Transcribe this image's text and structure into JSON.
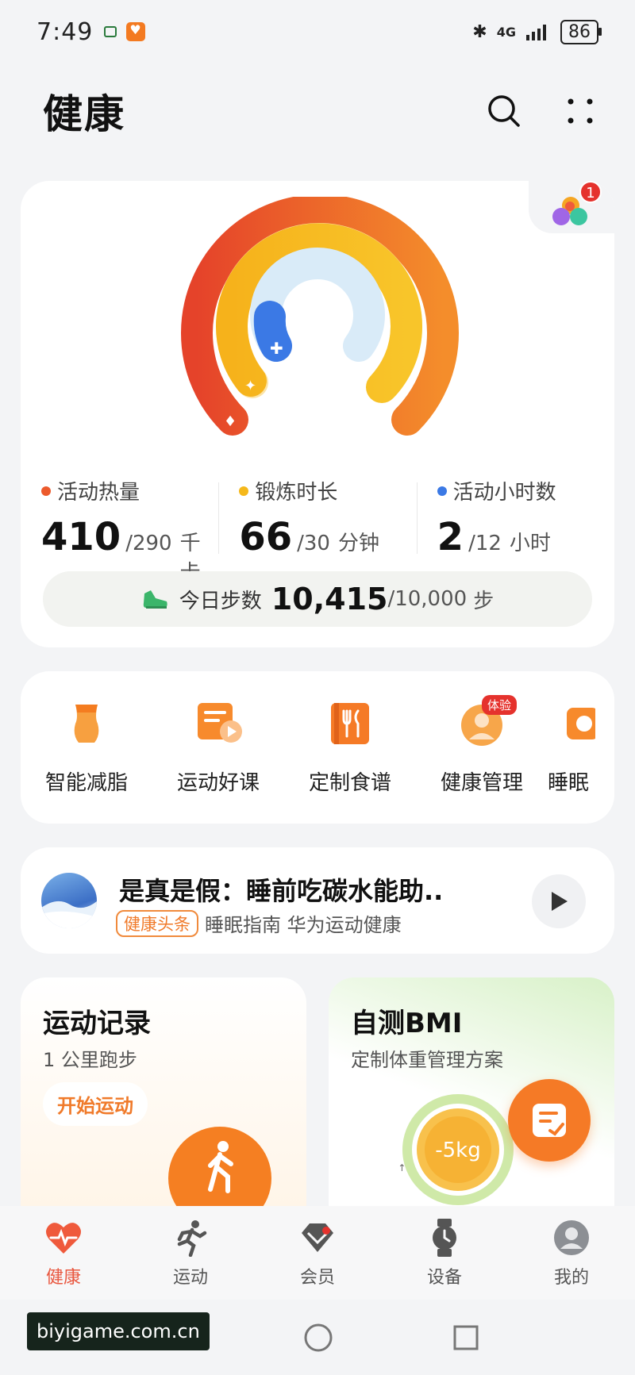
{
  "status_bar": {
    "time": "7:49",
    "network": "4G",
    "battery": "86"
  },
  "header": {
    "title": "健康"
  },
  "activity": {
    "metrics": [
      {
        "label": "活动热量",
        "value": "410",
        "goal": "/290",
        "unit": "千卡",
        "color": "#ec5a2c",
        "progress": 1.41
      },
      {
        "label": "锻炼时长",
        "value": "66",
        "goal": "/30",
        "unit": "分钟",
        "color": "#f5b81b",
        "progress": 2.2
      },
      {
        "label": "活动小时数",
        "value": "2",
        "goal": "/12",
        "unit": "小时",
        "color": "#3b79e5",
        "progress": 0.17
      }
    ],
    "steps": {
      "label": "今日步数",
      "value": "10,415",
      "goal": "/10,000",
      "unit": "步"
    },
    "notification_count": "1"
  },
  "services": [
    {
      "label": "智能减脂",
      "icon": "waist-icon"
    },
    {
      "label": "运动好课",
      "icon": "video-course-icon"
    },
    {
      "label": "定制食谱",
      "icon": "recipe-icon"
    },
    {
      "label": "健康管理",
      "icon": "health-manager-icon",
      "badge": "体验"
    },
    {
      "label": "睡眠",
      "icon": "sleep-icon"
    }
  ],
  "article": {
    "title": "是真是假：睡前吃碳水能助..",
    "tag": "健康头条",
    "meta": "睡眠指南 华为运动健康"
  },
  "record_card": {
    "title": "运动记录",
    "subtitle": "1 公里跑步",
    "button": "开始运动"
  },
  "bmi_card": {
    "title": "自测BMI",
    "subtitle": "定制体重管理方案",
    "gauge_label": "-5kg",
    "gauge_hint": "%↑"
  },
  "bottom_nav": [
    {
      "label": "健康",
      "icon": "heart-pulse-icon",
      "active": true
    },
    {
      "label": "运动",
      "icon": "runner-icon",
      "active": false
    },
    {
      "label": "会员",
      "icon": "diamond-icon",
      "active": false,
      "dot": true
    },
    {
      "label": "设备",
      "icon": "watch-icon",
      "active": false
    },
    {
      "label": "我的",
      "icon": "profile-icon",
      "active": false
    }
  ],
  "watermark": "biyigame.com.cn",
  "colors": {
    "accent": "#f57a26",
    "active_nav": "#e9573f",
    "badge": "#e5322d"
  }
}
